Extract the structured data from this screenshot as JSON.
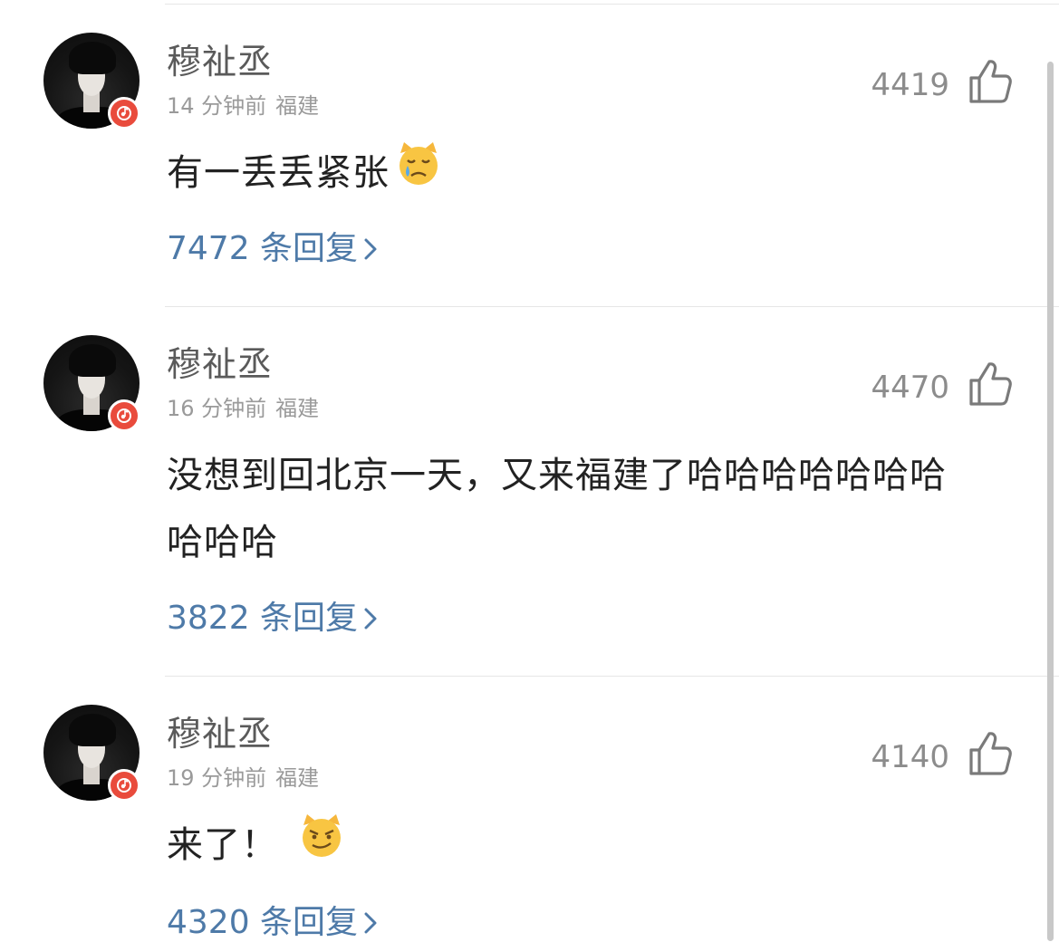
{
  "comments": [
    {
      "username": "穆祉丞",
      "time": "14 分钟前",
      "location": "福建",
      "likes": "4419",
      "text_lines": [
        "有一丢丢紧张"
      ],
      "emoji": "crying-cat-emoji",
      "replies": "7472 条回复"
    },
    {
      "username": "穆祉丞",
      "time": "16 分钟前",
      "location": "福建",
      "likes": "4470",
      "text_lines": [
        "没想到回北京一天，又来福建了哈哈哈哈哈哈哈",
        "哈哈哈"
      ],
      "emoji": "",
      "replies": "3822 条回复"
    },
    {
      "username": "穆祉丞",
      "time": "19 分钟前",
      "location": "福建",
      "likes": "4140",
      "text_lines": [
        "来了！"
      ],
      "emoji": "smirking-cat-emoji",
      "replies": "4320 条回复"
    }
  ],
  "colors": {
    "link": "#4e7aa8",
    "badge": "#e94b3c",
    "divider": "#e6e6e6"
  }
}
